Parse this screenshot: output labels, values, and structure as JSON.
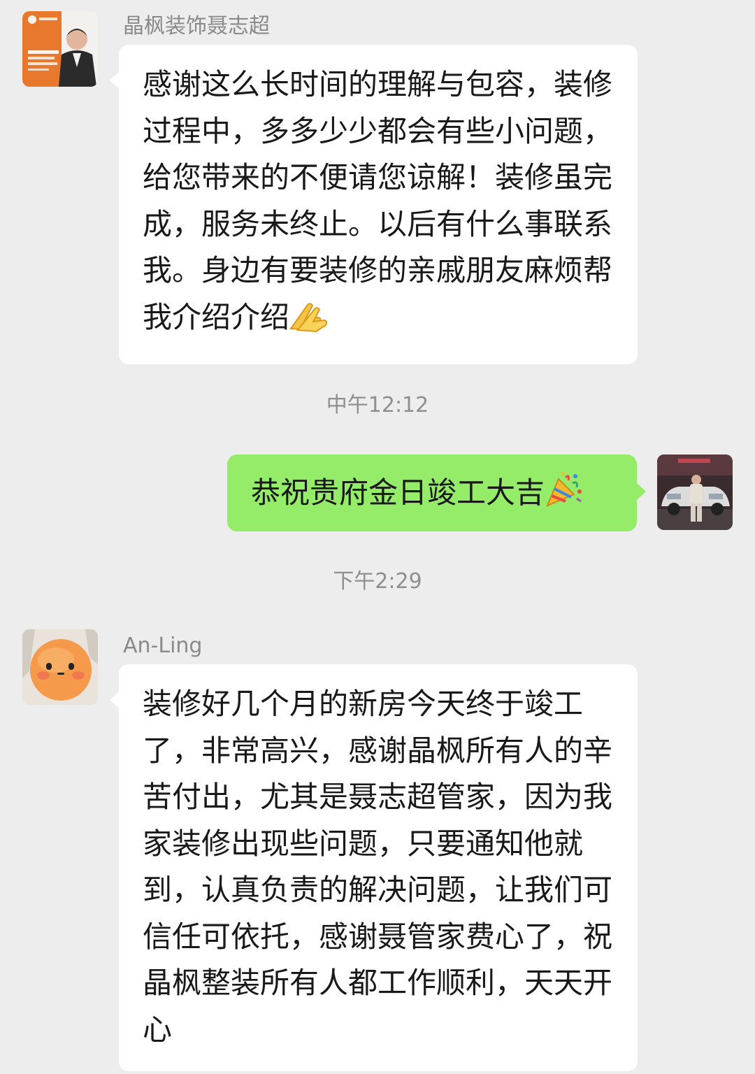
{
  "messages": [
    {
      "sender": "晶枫装饰聂志超",
      "direction": "incoming",
      "text": "感谢这么长时间的理解与包容，装修过程中，多多少少都会有些小问题，给您带来的不便请您谅解！装修虽完成，服务未终止。以后有什么事联系我。身边有要装修的亲戚朋友麻烦帮我介绍介绍",
      "emoji": "folded-hands-icon"
    },
    {
      "timestamp": "中午12:12"
    },
    {
      "direction": "outgoing",
      "text": "恭祝贵府金日竣工大吉",
      "emoji": "party-popper-icon"
    },
    {
      "timestamp": "下午2:29"
    },
    {
      "sender": "An-Ling",
      "direction": "incoming",
      "text": "装修好几个月的新房今天终于竣工了，非常高兴，感谢晶枫所有人的辛苦付出，尤其是聂志超管家，因为我家装修出现些问题，只要通知他就到，认真负责的解决问题，让我们可信任可依托，感谢聂管家费心了，祝晶枫整装所有人都工作顺利，天天开心"
    }
  ],
  "colors": {
    "background": "#ededed",
    "incoming_bubble": "#ffffff",
    "outgoing_bubble": "#95ec69",
    "name_text": "#8a8a8a",
    "timestamp_text": "#8f8f8f"
  }
}
